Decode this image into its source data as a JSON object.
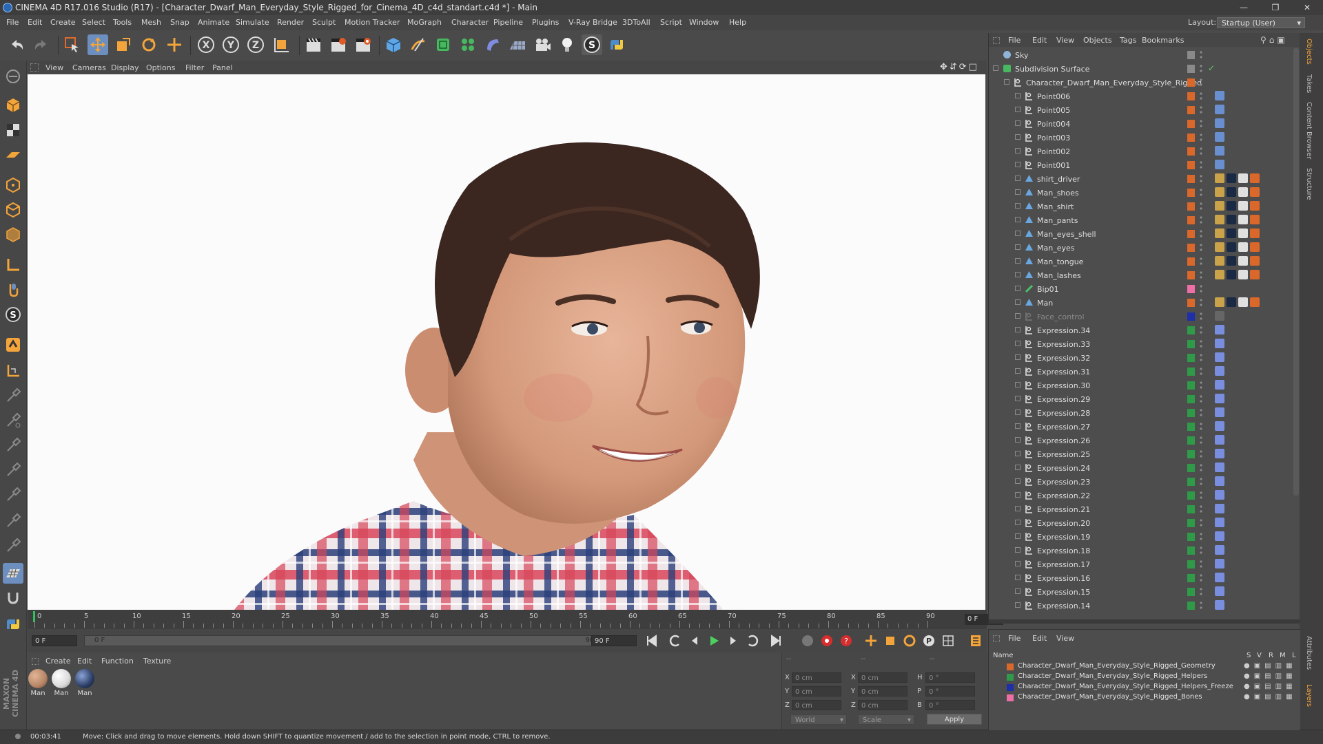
{
  "window": {
    "title": "CINEMA 4D R17.016 Studio (R17) - [Character_Dwarf_Man_Everyday_Style_Rigged_for_Cinema_4D_c4d_standart.c4d *] - Main"
  },
  "menubar": {
    "items": [
      "File",
      "Edit",
      "Create",
      "Select",
      "Tools",
      "Mesh",
      "Snap",
      "Animate",
      "Simulate",
      "Render",
      "Sculpt",
      "Motion Tracker",
      "MoGraph",
      "Character",
      "Pipeline",
      "Plugins",
      "V-Ray Bridge",
      "3DToAll",
      "Script",
      "Window",
      "Help"
    ],
    "layout_label": "Layout:",
    "layout_value": "Startup (User)"
  },
  "viewport": {
    "menu": [
      "View",
      "Cameras",
      "Display",
      "Options",
      "Filter",
      "Panel"
    ]
  },
  "timeline": {
    "ticks": [
      "0",
      "5",
      "10",
      "15",
      "20",
      "25",
      "30",
      "35",
      "40",
      "45",
      "50",
      "55",
      "60",
      "65",
      "70",
      "75",
      "80",
      "85",
      "90"
    ],
    "current_frame": "0 F"
  },
  "transport": {
    "start_field": "0 F",
    "slider_start": "0 F",
    "slider_end": "90 F",
    "end_field": "90 F"
  },
  "material_manager": {
    "menu": [
      "Create",
      "Edit",
      "Function",
      "Texture"
    ],
    "materials": [
      {
        "name": "Man",
        "color": "#b58566"
      },
      {
        "name": "Man",
        "color": "#d9d9d9"
      },
      {
        "name": "Man",
        "color": "#2c3e66"
      }
    ]
  },
  "coordinates": {
    "header": [
      "--",
      "--",
      "--"
    ],
    "rows": [
      {
        "a": "X",
        "av": "0 cm",
        "b": "X",
        "bv": "0 cm",
        "c": "H",
        "cv": "0 °"
      },
      {
        "a": "Y",
        "av": "0 cm",
        "b": "Y",
        "bv": "0 cm",
        "c": "P",
        "cv": "0 °"
      },
      {
        "a": "Z",
        "av": "0 cm",
        "b": "Z",
        "bv": "0 cm",
        "c": "B",
        "cv": "0 °"
      }
    ],
    "mode": "World",
    "scale": "Scale",
    "apply": "Apply"
  },
  "statusbar": {
    "time": "00:03:41",
    "message": "Move: Click and drag to move elements. Hold down SHIFT to quantize movement / add to the selection in point mode, CTRL to remove."
  },
  "object_manager": {
    "menu": [
      "File",
      "Edit",
      "View",
      "Objects",
      "Tags",
      "Bookmarks"
    ],
    "objects": [
      {
        "name": "Sky",
        "level": 0,
        "type": "sky",
        "color": "#8a8a8a"
      },
      {
        "name": "Subdivision Surface",
        "level": 0,
        "type": "subdiv",
        "color": "#8a8a8a"
      },
      {
        "name": "Character_Dwarf_Man_Everyday_Style_Rigged",
        "level": 1,
        "type": "null",
        "color": "#d9682a"
      },
      {
        "name": "Point006",
        "level": 2,
        "type": "null",
        "color": "#d9682a"
      },
      {
        "name": "Point005",
        "level": 2,
        "type": "null",
        "color": "#d9682a"
      },
      {
        "name": "Point004",
        "level": 2,
        "type": "null",
        "color": "#d9682a"
      },
      {
        "name": "Point003",
        "level": 2,
        "type": "null",
        "color": "#d9682a"
      },
      {
        "name": "Point002",
        "level": 2,
        "type": "null",
        "color": "#d9682a"
      },
      {
        "name": "Point001",
        "level": 2,
        "type": "null",
        "color": "#d9682a"
      },
      {
        "name": "shirt_driver",
        "level": 2,
        "type": "mesh",
        "color": "#d9682a"
      },
      {
        "name": "Man_shoes",
        "level": 2,
        "type": "mesh",
        "color": "#d9682a"
      },
      {
        "name": "Man_shirt",
        "level": 2,
        "type": "mesh",
        "color": "#d9682a"
      },
      {
        "name": "Man_pants",
        "level": 2,
        "type": "mesh",
        "color": "#d9682a"
      },
      {
        "name": "Man_eyes_shell",
        "level": 2,
        "type": "mesh",
        "color": "#d9682a"
      },
      {
        "name": "Man_eyes",
        "level": 2,
        "type": "mesh",
        "color": "#d9682a"
      },
      {
        "name": "Man_tongue",
        "level": 2,
        "type": "mesh",
        "color": "#d9682a"
      },
      {
        "name": "Man_lashes",
        "level": 2,
        "type": "mesh",
        "color": "#d9682a"
      },
      {
        "name": "Bip01",
        "level": 2,
        "type": "bone",
        "color": "#ee6fa5"
      },
      {
        "name": "Man",
        "level": 2,
        "type": "mesh",
        "color": "#d9682a"
      },
      {
        "name": "Face_control",
        "level": 2,
        "type": "null-dim",
        "color": "#1e2fa8"
      },
      {
        "name": "Expression.34",
        "level": 2,
        "type": "null",
        "color": "#2f9a48"
      },
      {
        "name": "Expression.33",
        "level": 2,
        "type": "null",
        "color": "#2f9a48"
      },
      {
        "name": "Expression.32",
        "level": 2,
        "type": "null",
        "color": "#2f9a48"
      },
      {
        "name": "Expression.31",
        "level": 2,
        "type": "null",
        "color": "#2f9a48"
      },
      {
        "name": "Expression.30",
        "level": 2,
        "type": "null",
        "color": "#2f9a48"
      },
      {
        "name": "Expression.29",
        "level": 2,
        "type": "null",
        "color": "#2f9a48"
      },
      {
        "name": "Expression.28",
        "level": 2,
        "type": "null",
        "color": "#2f9a48"
      },
      {
        "name": "Expression.27",
        "level": 2,
        "type": "null",
        "color": "#2f9a48"
      },
      {
        "name": "Expression.26",
        "level": 2,
        "type": "null",
        "color": "#2f9a48"
      },
      {
        "name": "Expression.25",
        "level": 2,
        "type": "null",
        "color": "#2f9a48"
      },
      {
        "name": "Expression.24",
        "level": 2,
        "type": "null",
        "color": "#2f9a48"
      },
      {
        "name": "Expression.23",
        "level": 2,
        "type": "null",
        "color": "#2f9a48"
      },
      {
        "name": "Expression.22",
        "level": 2,
        "type": "null",
        "color": "#2f9a48"
      },
      {
        "name": "Expression.21",
        "level": 2,
        "type": "null",
        "color": "#2f9a48"
      },
      {
        "name": "Expression.20",
        "level": 2,
        "type": "null",
        "color": "#2f9a48"
      },
      {
        "name": "Expression.19",
        "level": 2,
        "type": "null",
        "color": "#2f9a48"
      },
      {
        "name": "Expression.18",
        "level": 2,
        "type": "null",
        "color": "#2f9a48"
      },
      {
        "name": "Expression.17",
        "level": 2,
        "type": "null",
        "color": "#2f9a48"
      },
      {
        "name": "Expression.16",
        "level": 2,
        "type": "null",
        "color": "#2f9a48"
      },
      {
        "name": "Expression.15",
        "level": 2,
        "type": "null",
        "color": "#2f9a48"
      },
      {
        "name": "Expression.14",
        "level": 2,
        "type": "null",
        "color": "#2f9a48"
      }
    ]
  },
  "layer_manager": {
    "menu": [
      "File",
      "Edit",
      "View"
    ],
    "columns": [
      "Name",
      "S",
      "V",
      "R",
      "M",
      "L"
    ],
    "layers": [
      {
        "name": "Character_Dwarf_Man_Everyday_Style_Rigged_Geometry",
        "color": "#d9682a"
      },
      {
        "name": "Character_Dwarf_Man_Everyday_Style_Rigged_Helpers",
        "color": "#2f9a48"
      },
      {
        "name": "Character_Dwarf_Man_Everyday_Style_Rigged_Helpers_Freeze",
        "color": "#1e2fa8"
      },
      {
        "name": "Character_Dwarf_Man_Everyday_Style_Rigged_Bones",
        "color": "#ee6fa5"
      }
    ]
  },
  "side_tabs": [
    "Objects",
    "Takes",
    "Content Browser",
    "Structure",
    "Attributes",
    "Layers"
  ]
}
